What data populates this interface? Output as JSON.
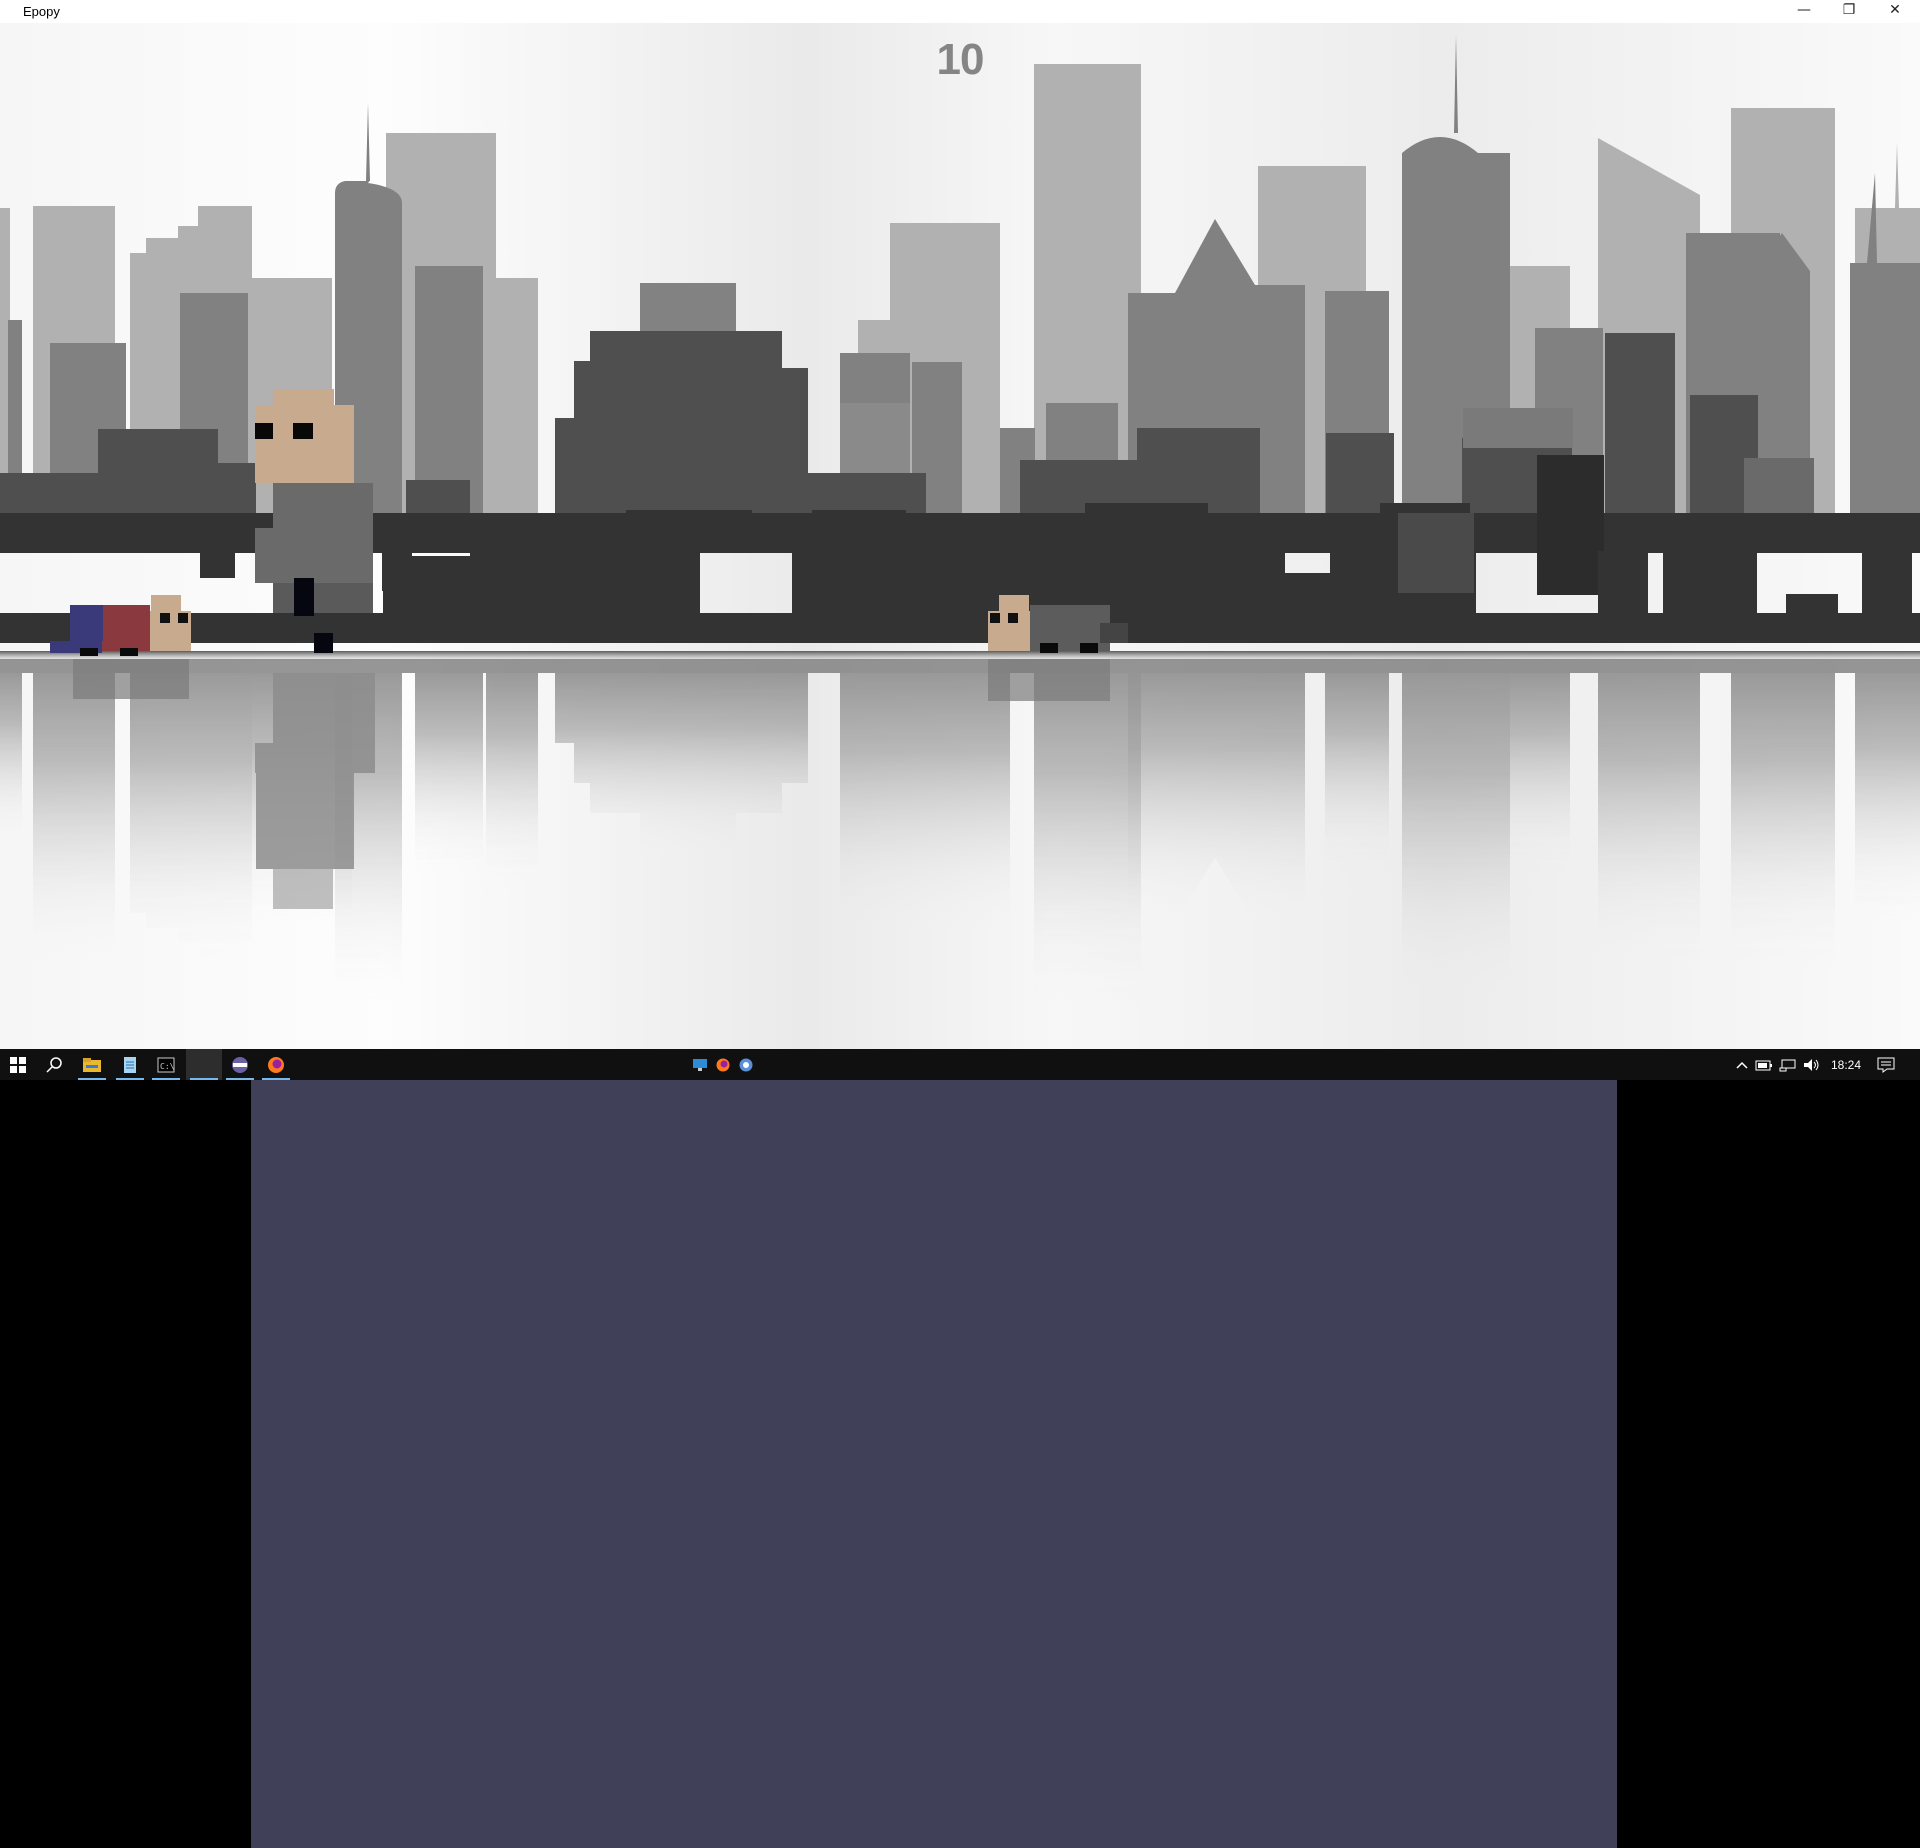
{
  "window": {
    "title": "Epopy",
    "minimize_glyph": "—",
    "restore_glyph": "❐",
    "close_glyph": "✕"
  },
  "game": {
    "score": "10",
    "background": "grayscale city skyline with water reflection",
    "player": "tall pixel character with tan head and gray body",
    "enemies": [
      "red-blue crawling blob (left)",
      "gray crawling blob (center)"
    ]
  },
  "taskbar": {
    "start_icon": "windows-logo-icon",
    "search_icon": "search-icon",
    "pinned": [
      {
        "name": "file-explorer-icon",
        "active": true
      },
      {
        "name": "notepad-icon",
        "active": true
      },
      {
        "name": "terminal-icon",
        "active": true
      },
      {
        "name": "game-window-icon",
        "active": true
      },
      {
        "name": "vpn-icon",
        "active": true
      },
      {
        "name": "firefox-icon",
        "active": true
      }
    ],
    "center_icons": [
      "remote-desktop-icon",
      "firefox-icon",
      "chromium-icon"
    ],
    "tray": {
      "clock": "18:24",
      "icons": [
        "chevron-up-icon",
        "battery-icon",
        "network-icon",
        "volume-icon",
        "notifications-icon"
      ]
    }
  },
  "secondary_display": {
    "panel_color": "#404058"
  }
}
